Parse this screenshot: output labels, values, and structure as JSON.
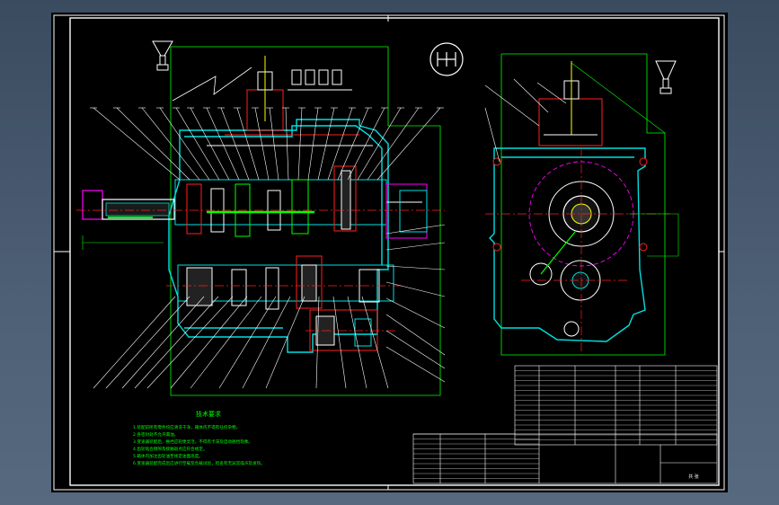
{
  "drawing": {
    "background_color": "#000000",
    "window_color": "#4a5b70",
    "frame_color": "#ffffff",
    "cad_green": "#00ff00",
    "cad_red": "#ff2020",
    "cad_cyan": "#00e0e0",
    "cad_magenta": "#ff00ff",
    "cad_yellow": "#ffff00",
    "shift_pattern_icon": "gear-shift-pattern-icon",
    "notes": {
      "heading": "技术要求",
      "lines": [
        "1.装配前所有零件均应清洗干净，箱体内不得有任何杂物。",
        "2.各密封处不允许漏油。",
        "3.变速器装配后，换挡应轻便灵活，不得有卡滞及自动脱挡现象。",
        "4.齿轮啮合侧隙及接触斑点应符合规定。",
        "5.箱体内加注齿轮油至规定油面高度。",
        "6.变速器装配完成后应进行空载及负载试验，检查有无异常噪声及发热。"
      ]
    },
    "title_block": {
      "drawing_title": "",
      "sheet_mark": "共 张"
    }
  }
}
